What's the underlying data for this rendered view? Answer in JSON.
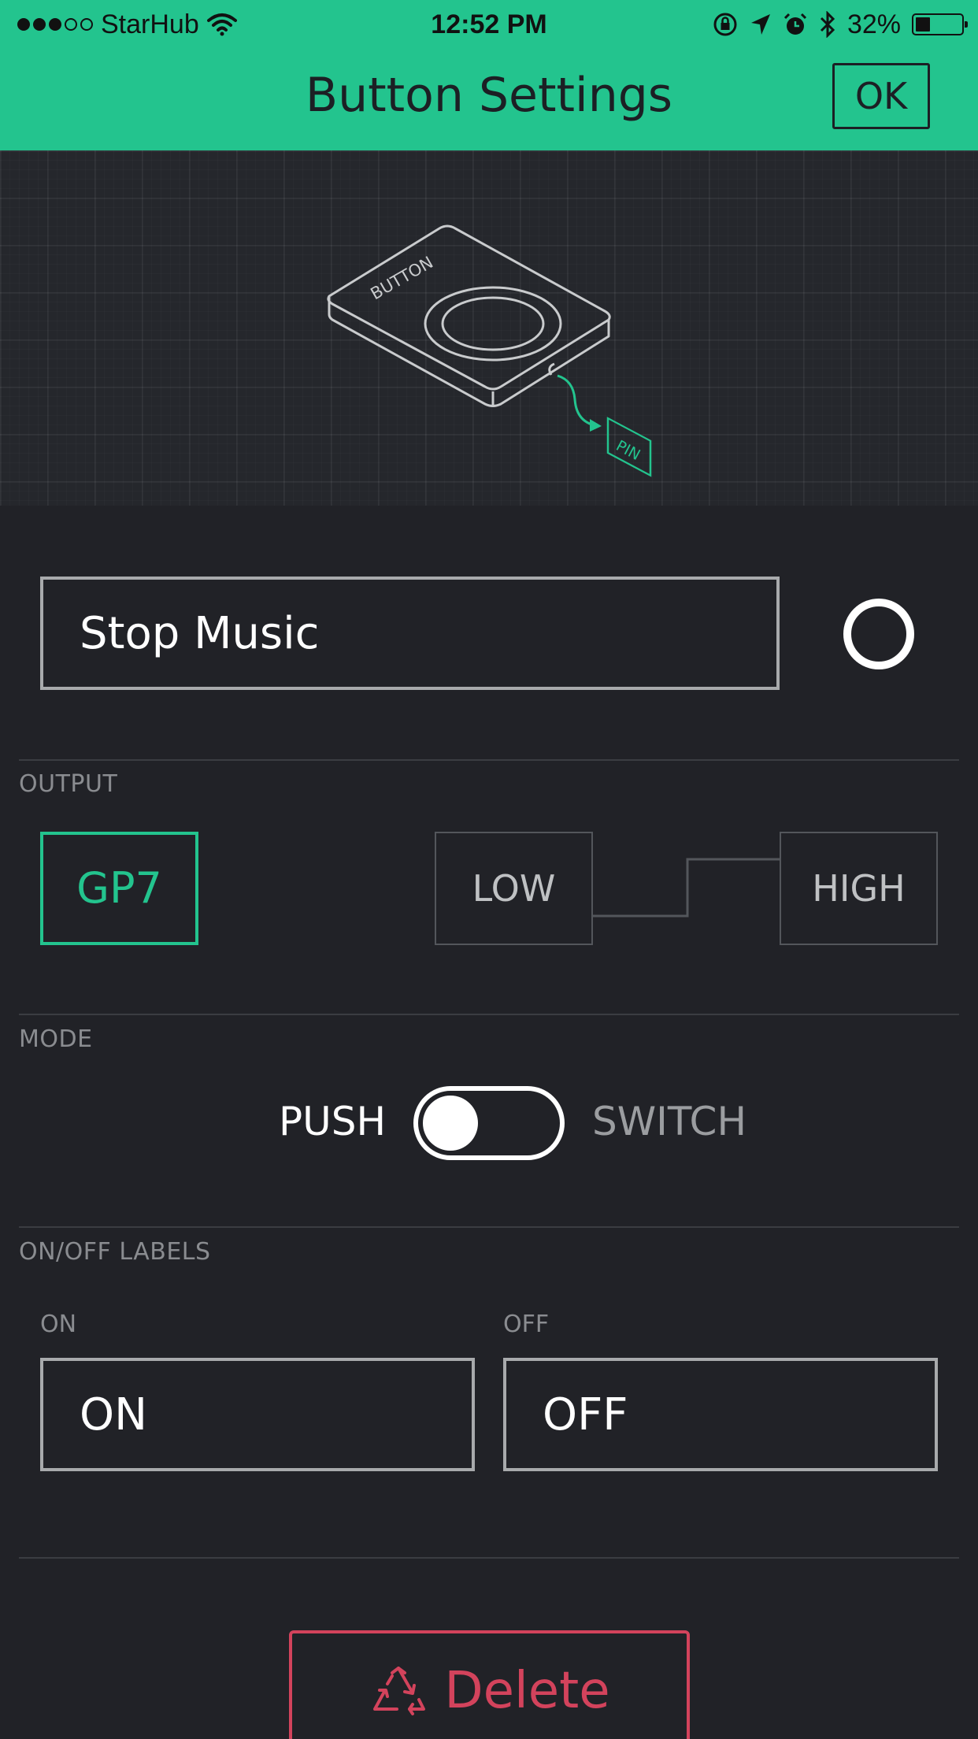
{
  "status_bar": {
    "carrier": "StarHub",
    "time": "12:52 PM",
    "battery": "32%",
    "battery_level": 0.32
  },
  "header": {
    "title": "Button Settings",
    "ok_label": "OK"
  },
  "illustration": {
    "button_label": "BUTTON",
    "pin_label": "PIN"
  },
  "widget": {
    "name": "Stop Music",
    "color": "#ffffff"
  },
  "output": {
    "section_label": "OUTPUT",
    "pin": "GP7",
    "low_label": "LOW",
    "high_label": "HIGH"
  },
  "mode": {
    "section_label": "MODE",
    "push_label": "PUSH",
    "switch_label": "SWITCH",
    "selected": "PUSH"
  },
  "labels": {
    "section_label": "ON/OFF LABELS",
    "on_caption": "ON",
    "off_caption": "OFF",
    "on_value": "ON",
    "off_value": "OFF"
  },
  "delete": {
    "label": "Delete"
  },
  "colors": {
    "accent": "#23c48e",
    "background": "#212227",
    "danger": "#d3435c"
  }
}
